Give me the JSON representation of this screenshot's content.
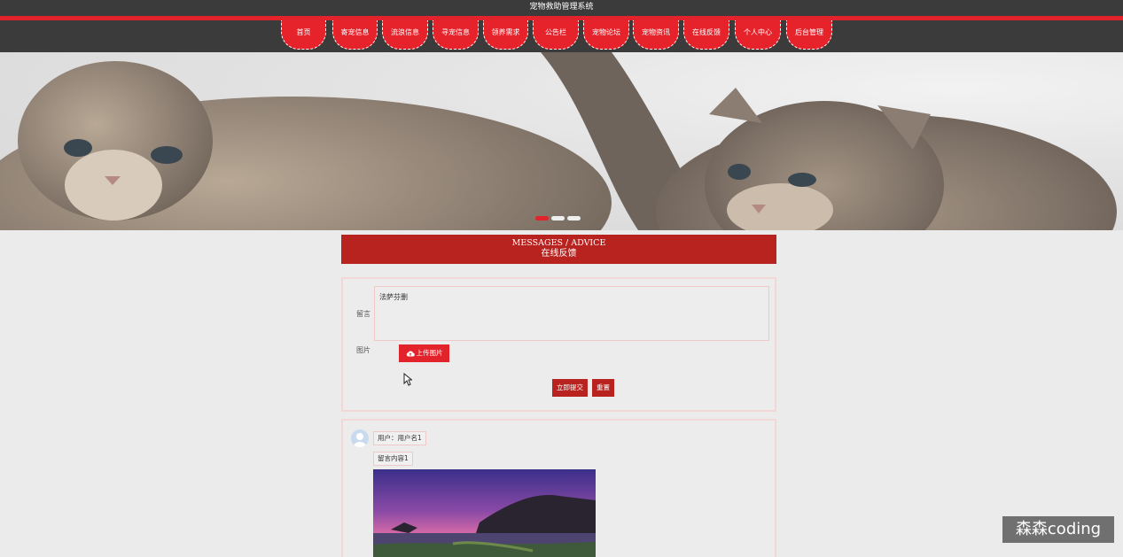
{
  "app": {
    "title": "宠物救助管理系统"
  },
  "nav": {
    "items": [
      {
        "label": "首页"
      },
      {
        "label": "寄宠信息"
      },
      {
        "label": "流浪信息"
      },
      {
        "label": "寻宠信息"
      },
      {
        "label": "领养需求"
      },
      {
        "label": "公告栏"
      },
      {
        "label": "宠物论坛"
      },
      {
        "label": "宠物资讯"
      },
      {
        "label": "在线反馈"
      },
      {
        "label": "个人中心"
      },
      {
        "label": "后台管理"
      }
    ]
  },
  "banner": {
    "slides": 3,
    "active_slide": 1
  },
  "section": {
    "title_en": "MESSAGES / ADVICE",
    "title_cn": "在线反馈"
  },
  "form": {
    "message_label": "留言",
    "message_value": "法萨芬删",
    "image_label": "图片",
    "upload_label": "上传图片",
    "submit_label": "立即提交",
    "reset_label": "重置"
  },
  "messages": [
    {
      "user": "用户：用户名1",
      "content": "留言内容1"
    }
  ],
  "watermark": "森森coding",
  "colors": {
    "accent": "#e3232b",
    "dark_accent": "#b8231f",
    "header_bg": "#3b3b3b"
  }
}
